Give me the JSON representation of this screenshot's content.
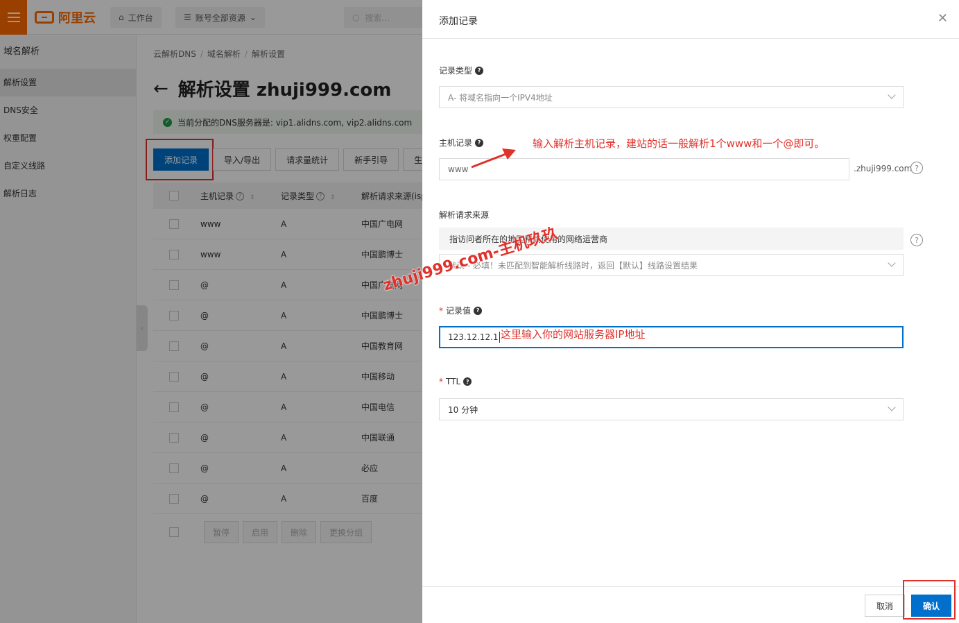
{
  "topbar": {
    "logo_text": "阿里云",
    "workbench": "工作台",
    "resources": "账号全部资源",
    "search_placeholder": "搜索..."
  },
  "sidenav": {
    "title": "域名解析",
    "items": [
      "解析设置",
      "DNS安全",
      "权重配置",
      "自定义线路",
      "解析日志"
    ]
  },
  "breadcrumb": [
    "云解析DNS",
    "域名解析",
    "解析设置"
  ],
  "page_title": "解析设置 zhuji999.com",
  "dns_banner": "当前分配的DNS服务器是: vip1.alidns.com, vip2.alidns.com",
  "toolbar": {
    "add": "添加记录",
    "import_export": "导入/导出",
    "stats": "请求量统计",
    "guide": "新手引导",
    "more": "生效"
  },
  "table": {
    "headers": {
      "host": "主机记录",
      "type": "记录类型",
      "source": "解析请求来源(isp"
    },
    "rows": [
      {
        "host": "www",
        "type": "A",
        "source": "中国广电网"
      },
      {
        "host": "www",
        "type": "A",
        "source": "中国鹏博士"
      },
      {
        "host": "@",
        "type": "A",
        "source": "中国广电网"
      },
      {
        "host": "@",
        "type": "A",
        "source": "中国鹏博士"
      },
      {
        "host": "@",
        "type": "A",
        "source": "中国教育网"
      },
      {
        "host": "@",
        "type": "A",
        "source": "中国移动"
      },
      {
        "host": "@",
        "type": "A",
        "source": "中国电信"
      },
      {
        "host": "@",
        "type": "A",
        "source": "中国联通"
      },
      {
        "host": "@",
        "type": "A",
        "source": "必应"
      },
      {
        "host": "@",
        "type": "A",
        "source": "百度"
      }
    ],
    "actions": {
      "pause": "暂停",
      "enable": "启用",
      "delete": "删除",
      "change_group": "更换分组"
    }
  },
  "drawer": {
    "title": "添加记录",
    "record_type": {
      "label": "记录类型",
      "value": "A- 将域名指向一个IPV4地址"
    },
    "host": {
      "label": "主机记录",
      "value": "www",
      "suffix": ".zhuji999.com"
    },
    "source": {
      "label": "解析请求来源",
      "hint": "指访问者所在的地区和其使用的网络运营商",
      "value": "默认 - 必填！未匹配到智能解析线路时，返回【默认】线路设置结果"
    },
    "record_value": {
      "label": "记录值",
      "value": "123.12.12.1"
    },
    "ttl": {
      "label": "TTL",
      "value": "10 分钟"
    },
    "cancel": "取消",
    "confirm": "确认"
  },
  "annotations": {
    "host_tip": "输入解析主机记录，建站的话一般解析1个www和一个@即可。",
    "value_tip": "这里输入你的网站服务器IP地址",
    "watermark": "zhuji999.com-主机玖玖"
  },
  "colors": {
    "accent": "#0070cc",
    "brand": "#ff6a00",
    "annotation": "#e0312b"
  }
}
